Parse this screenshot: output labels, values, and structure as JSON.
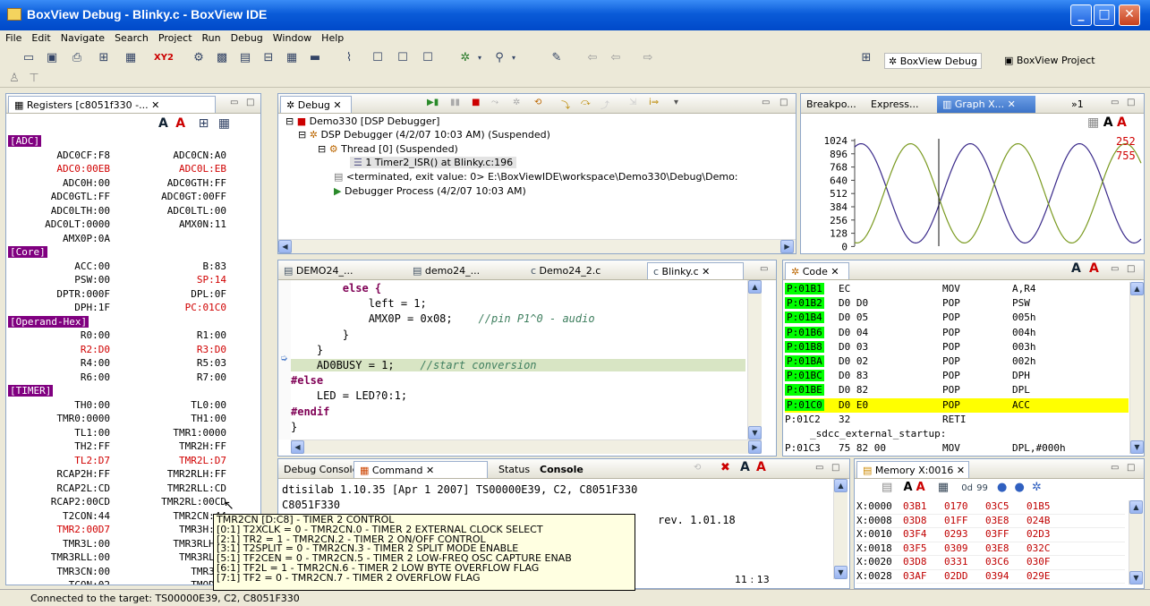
{
  "window": {
    "title": "BoxView Debug - Blinky.c - BoxView IDE"
  },
  "menu": [
    "File",
    "Edit",
    "Navigate",
    "Search",
    "Project",
    "Run",
    "Debug",
    "Window",
    "Help"
  ],
  "perspectives": {
    "debug": "BoxView Debug",
    "project": "BoxView Project"
  },
  "registers": {
    "title": "Registers [c8051f330 -...",
    "groups": [
      {
        "name": "[ADC]",
        "rows": [
          [
            "ADC0CF:F8",
            "ADC0CN:A0"
          ],
          [
            "ADC0:00EB",
            "ADC0L:EB"
          ],
          [
            "ADC0H:00",
            "ADC0GTH:FF"
          ],
          [
            "ADC0GTL:FF",
            "ADC0GT:00FF"
          ],
          [
            "ADC0LTH:00",
            "ADC0LTL:00"
          ],
          [
            "ADC0LT:0000",
            "AMX0N:11"
          ],
          [
            "AMX0P:0A",
            ""
          ]
        ]
      },
      {
        "name": "[Core]",
        "rows": [
          [
            "ACC:00",
            "B:83"
          ],
          [
            "PSW:00",
            "SP:14"
          ],
          [
            "DPTR:000F",
            "DPL:0F"
          ],
          [
            "DPH:1F",
            "PC:01C0"
          ]
        ]
      },
      {
        "name": "[Operand-Hex]",
        "rows": [
          [
            "R0:00",
            "R1:00"
          ],
          [
            "R2:D0",
            "R3:D0"
          ],
          [
            "R4:00",
            "R5:03"
          ],
          [
            "R6:00",
            "R7:00"
          ]
        ]
      },
      {
        "name": "[TIMER]",
        "rows": [
          [
            "TH0:00",
            "TL0:00"
          ],
          [
            "TMR0:0000",
            "TH1:00"
          ],
          [
            "TL1:00",
            "TMR1:0000"
          ],
          [
            "TH2:FF",
            "TMR2H:FF"
          ],
          [
            "TL2:D7",
            "TMR2L:D7"
          ],
          [
            "RCAP2H:FF",
            "TMR2RLH:FF"
          ],
          [
            "RCAP2L:CD",
            "TMR2RLL:CD"
          ],
          [
            "RCAP2:00CD",
            "TMR2RL:00CD"
          ],
          [
            "T2CON:44",
            "TMR2CN:44"
          ],
          [
            "TMR2:00D7",
            "TMR3H:00"
          ],
          [
            "TMR3L:00",
            "TMR3RLH:0"
          ],
          [
            "TMR3RLL:00",
            "TMR3RL:0"
          ],
          [
            "TMR3CN:00",
            "TMR3:0"
          ],
          [
            "TCON:02",
            "TMOD:0"
          ]
        ]
      }
    ]
  },
  "debug": {
    "tab": "Debug",
    "tree": [
      "Demo330 [DSP Debugger]",
      "DSP Debugger (4/2/07 10:03 AM) (Suspended)",
      "Thread [0] (Suspended)",
      "1 Timer2_ISR() at Blinky.c:196",
      "<terminated, exit value: 0> E:\\BoxViewIDE\\workspace\\Demo330\\Debug\\Demo:",
      "Debugger Process (4/2/07 10:03 AM)"
    ]
  },
  "graph": {
    "tabs": [
      "Breakpo...",
      "Express...",
      "Graph X...",
      "»1"
    ],
    "yticks": [
      "1024",
      "896",
      "768",
      "640",
      "512",
      "384",
      "256",
      "128",
      "0"
    ],
    "readout": [
      "252",
      "755"
    ]
  },
  "editor": {
    "tabs": [
      "DEMO24_...",
      "demo24_...",
      "Demo24_2.c",
      "Blinky.c"
    ],
    "lines": [
      {
        "code": "        else {",
        "kind": "kw"
      },
      {
        "code": "            left = 1;",
        "kind": "plain"
      },
      {
        "code": "            AMX0P = 0x08;",
        "comment": "    //pin P1^0 - audio",
        "kind": "plain"
      },
      {
        "code": "        }",
        "kind": "plain"
      },
      {
        "code": "    }",
        "kind": "plain"
      },
      {
        "code": "    AD0BUSY = 1;",
        "comment": "    //start conversion",
        "kind": "current"
      },
      {
        "code": "#else",
        "kind": "kw"
      },
      {
        "code": "    LED = LED?0:1;",
        "kind": "plain"
      },
      {
        "code": "#endif",
        "kind": "kw"
      },
      {
        "code": "}",
        "kind": "plain"
      }
    ]
  },
  "code": {
    "tab": "Code",
    "rows": [
      [
        "P:01B1",
        "EC",
        "MOV",
        "A,R4"
      ],
      [
        "P:01B2",
        "D0 D0",
        "POP",
        "PSW"
      ],
      [
        "P:01B4",
        "D0 05",
        "POP",
        "005h"
      ],
      [
        "P:01B6",
        "D0 04",
        "POP",
        "004h"
      ],
      [
        "P:01B8",
        "D0 03",
        "POP",
        "003h"
      ],
      [
        "P:01BA",
        "D0 02",
        "POP",
        "002h"
      ],
      [
        "P:01BC",
        "D0 83",
        "POP",
        "DPH"
      ],
      [
        "P:01BE",
        "D0 82",
        "POP",
        "DPL"
      ],
      [
        "P:01C0",
        "D0 E0",
        "POP",
        "ACC"
      ],
      [
        "P:01C2",
        "32",
        "RETI",
        ""
      ],
      [
        "",
        "_sdcc_external_startup:",
        "",
        ""
      ],
      [
        "P:01C3",
        "75 82 00",
        "MOV",
        "DPL,#000h"
      ]
    ]
  },
  "console": {
    "tabs": [
      "Debug Console",
      "Command",
      "Status",
      "Console"
    ],
    "lines": [
      "dtisilab 1.10.35 [Apr  1 2007] TS00000E39, C2, C8051F330",
      "C8051F330",
      "rev. 1.01.18"
    ],
    "position": "11 : 13"
  },
  "memory": {
    "tab": "Memory X:0016",
    "rows": [
      [
        "X:0000",
        "03B1",
        "0170",
        "03C5",
        "01B5"
      ],
      [
        "X:0008",
        "03D8",
        "01FF",
        "03E8",
        "024B"
      ],
      [
        "X:0010",
        "03F4",
        "0293",
        "03FF",
        "02D3"
      ],
      [
        "X:0018",
        "03F5",
        "0309",
        "03E8",
        "032C"
      ],
      [
        "X:0020",
        "03D8",
        "0331",
        "03C6",
        "030F"
      ],
      [
        "X:0028",
        "03AF",
        "02DD",
        "0394",
        "029E"
      ]
    ]
  },
  "tooltip": [
    "TMR2CN [D:C8] - TIMER 2 CONTROL",
    "[0:1] T2XCLK = 0 - TMR2CN.0 - TIMER 2 EXTERNAL CLOCK SELECT",
    "[2:1] TR2 = 1 - TMR2CN.2 - TIMER 2 ON/OFF CONTROL",
    "[3:1] T2SPLIT = 0 - TMR2CN.3 - TIMER 2 SPLIT MODE ENABLE",
    "[5:1] TF2CEN = 0 - TMR2CN.5 - TIMER 2 LOW-FREQ OSC CAPTURE ENAB",
    "[6:1] TF2L = 1 - TMR2CN.6 - TIMER 2 LOW BYTE OVERFLOW FLAG",
    "[7:1] TF2 = 0 - TMR2CN.7 - TIMER 2 OVERFLOW FLAG"
  ],
  "status": "Connected to the target: TS00000E39, C2, C8051F330"
}
